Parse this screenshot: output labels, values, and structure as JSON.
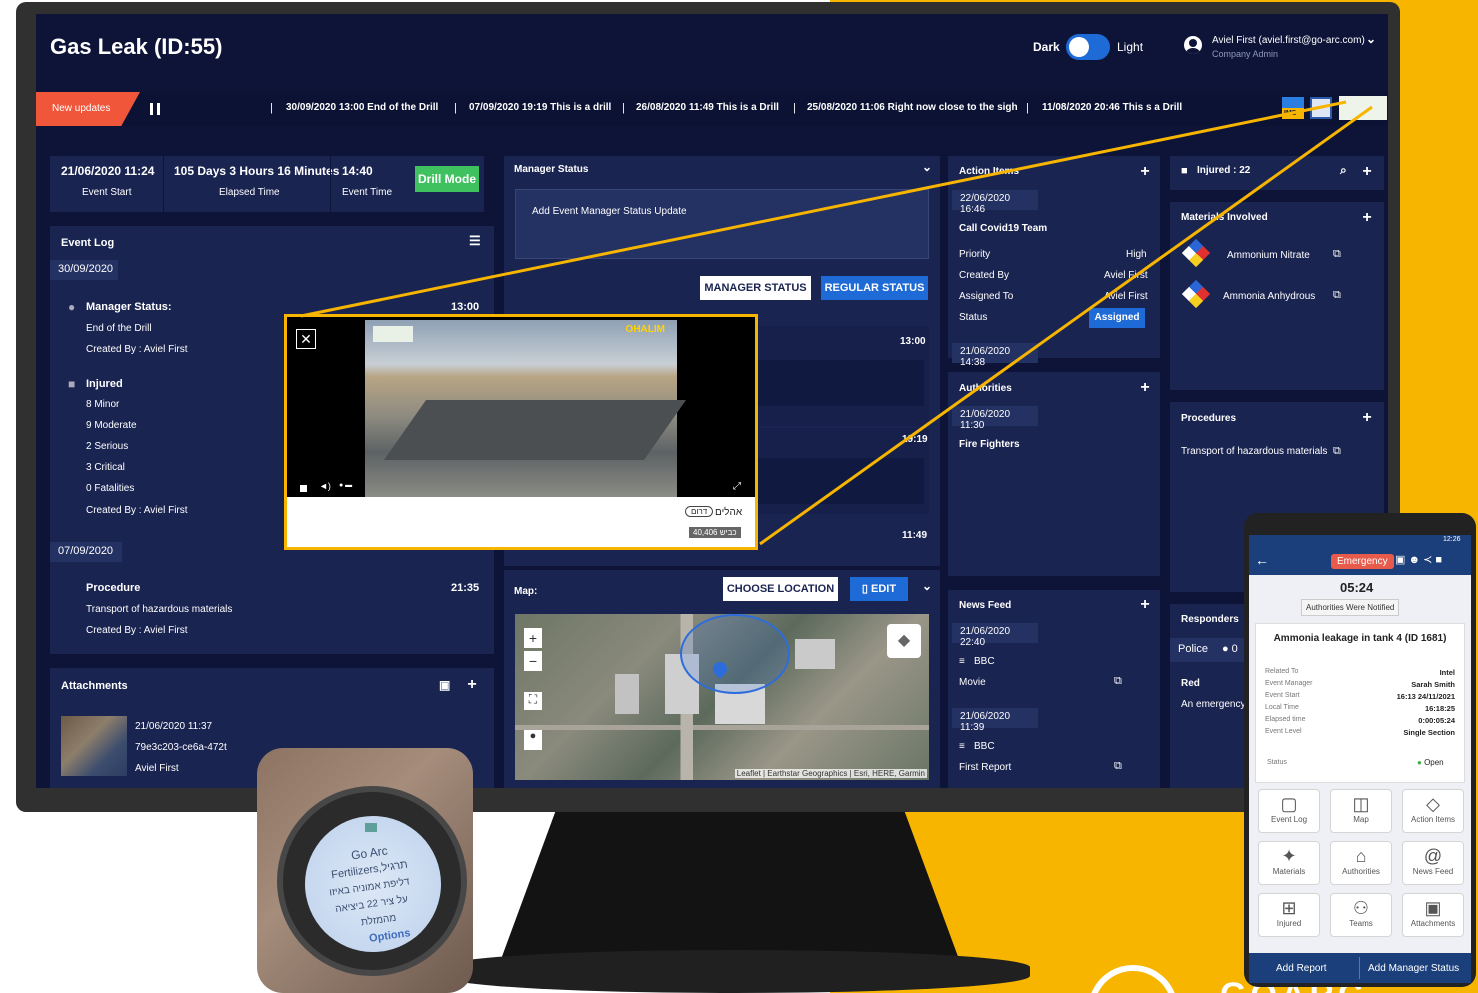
{
  "header": {
    "title": "Gas Leak (ID:55)",
    "theme_dark": "Dark",
    "theme_light": "Light",
    "user_name": "Aviel First (aviel.first@go-arc.com)",
    "user_role": "Company Admin"
  },
  "ticker": {
    "badge": "New updates",
    "items": [
      "30/09/2020 13:00 End of the Drill",
      "07/09/2020 19:19 This is a drill",
      "26/08/2020 11:49 This is a Drill",
      "25/08/2020 11:06 Right now close to the sigh",
      "11/08/2020 20:46 This s a Drill"
    ],
    "logo_ims": "IMS"
  },
  "timebar": {
    "event_start_value": "21/06/2020 11:24",
    "event_start_label": "Event Start",
    "elapsed_value": "105 Days 3 Hours 16 Minutes",
    "elapsed_label": "Elapsed Time",
    "event_time_value": "14:40",
    "event_time_label": "Event Time",
    "drill_mode": "Drill Mode"
  },
  "event_log": {
    "title": "Event Log",
    "date1": "30/09/2020",
    "manager_status_label": "Manager Status:",
    "manager_status_time": "13:00",
    "manager_status_text": "End of the Drill",
    "created_by_1": "Created By : Aviel First",
    "injured_label": "Injured",
    "injured_lines": [
      "8 Minor",
      "9 Moderate",
      "2 Serious",
      "3 Critical",
      "0 Fatalities"
    ],
    "created_by_2": "Created By : Aviel First",
    "date2": "07/09/2020",
    "procedure_label": "Procedure",
    "procedure_time": "21:35",
    "procedure_text": "Transport of hazardous materials",
    "created_by_3": "Created By : Aviel First"
  },
  "attachments": {
    "title": "Attachments",
    "date": "21/06/2020 11:37",
    "id": "79e3c203-ce6a-472t",
    "author": "Aviel First"
  },
  "manager_status": {
    "title": "Manager Status",
    "add_prompt": "Add Event Manager Status Update",
    "btn_manager": "MANAGER STATUS",
    "btn_regular": "REGULAR STATUS",
    "times": [
      "13:00",
      "19:19",
      "11:49"
    ]
  },
  "map": {
    "title": "Map:",
    "choose_location": "CHOOSE LOCATION",
    "edit": "EDIT",
    "attribution": "Leaflet | Earthstar Geographics | Esri, HERE, Garmin",
    "zoom_in": "+",
    "zoom_out": "−"
  },
  "action_items": {
    "title": "Action Items",
    "date": "22/06/2020 16:46",
    "item_title": "Call Covid19 Team",
    "rows": [
      {
        "label": "Priority",
        "value": "High"
      },
      {
        "label": "Created By",
        "value": "Aviel First"
      },
      {
        "label": "Assigned To",
        "value": "Aviel First"
      }
    ],
    "status_label": "Status",
    "status_value": "Assigned",
    "date2": "21/06/2020 14:38"
  },
  "authorities": {
    "title": "Authorities",
    "date": "21/06/2020 11:30",
    "item": "Fire Fighters"
  },
  "news_feed": {
    "title": "News Feed",
    "entries": [
      {
        "date": "21/06/2020 22:40",
        "source": "BBC",
        "item": "Movie"
      },
      {
        "date": "21/06/2020 11:39",
        "source": "BBC",
        "item": "First Report"
      }
    ]
  },
  "injured_panel": {
    "label": "Injured : 22"
  },
  "materials": {
    "title": "Materials Involved",
    "items": [
      "Ammonium Nitrate",
      "Ammonia Anhydrous"
    ]
  },
  "procedures": {
    "title": "Procedures",
    "item": "Transport of hazardous materials"
  },
  "responders": {
    "title": "Responders",
    "police": "Police",
    "police_count": "0",
    "red": "Red",
    "red_text": "An emergency tea"
  },
  "video": {
    "overlay_text": "OHALIM",
    "caption_hebrew": "אהלים",
    "caption_tag": "דרום",
    "caption_road": "כביש 40,406"
  },
  "watch": {
    "brand": "Go Arc",
    "line1": "Fertilizers,תרגיל",
    "line2": "דליפת אמוניה באיזו",
    "line3": "על ציר 22 ביציאה",
    "line4": "מהמזלת",
    "options": "Options"
  },
  "phone": {
    "emergency": "Emergency",
    "time": "12:26",
    "countdown": "05:24",
    "authorities_notified": "Authorities Were Notified",
    "event_title": "Ammonia leakage in tank 4 (ID 1681)",
    "details": [
      {
        "label": "Related To",
        "value": "Intel"
      },
      {
        "label": "Event Manager",
        "value": "Sarah Smith"
      },
      {
        "label": "Event Start",
        "value": "16:13 24/11/2021"
      },
      {
        "label": "Local Time",
        "value": "16:18:25"
      },
      {
        "label": "Elapsed time",
        "value": "0:00:05:24"
      },
      {
        "label": "Event Level",
        "value": "Single Section"
      }
    ],
    "status_label": "Status",
    "status_value": "Open",
    "tiles": [
      "Event Log",
      "Map",
      "Action Items",
      "Materials",
      "Authorities",
      "News Feed",
      "Injured",
      "Teams",
      "Attachments"
    ],
    "add_report": "Add Report",
    "add_manager_status": "Add Manager Status"
  },
  "brand_bottom": "GOARC",
  "colors": {
    "screen_bg": "#0d1438",
    "panel_bg": "#1a2451",
    "accent_blue": "#1e6ad6",
    "drill_green": "#3fc160",
    "new_updates": "#f0563a",
    "brand_yellow": "#f7b500"
  }
}
